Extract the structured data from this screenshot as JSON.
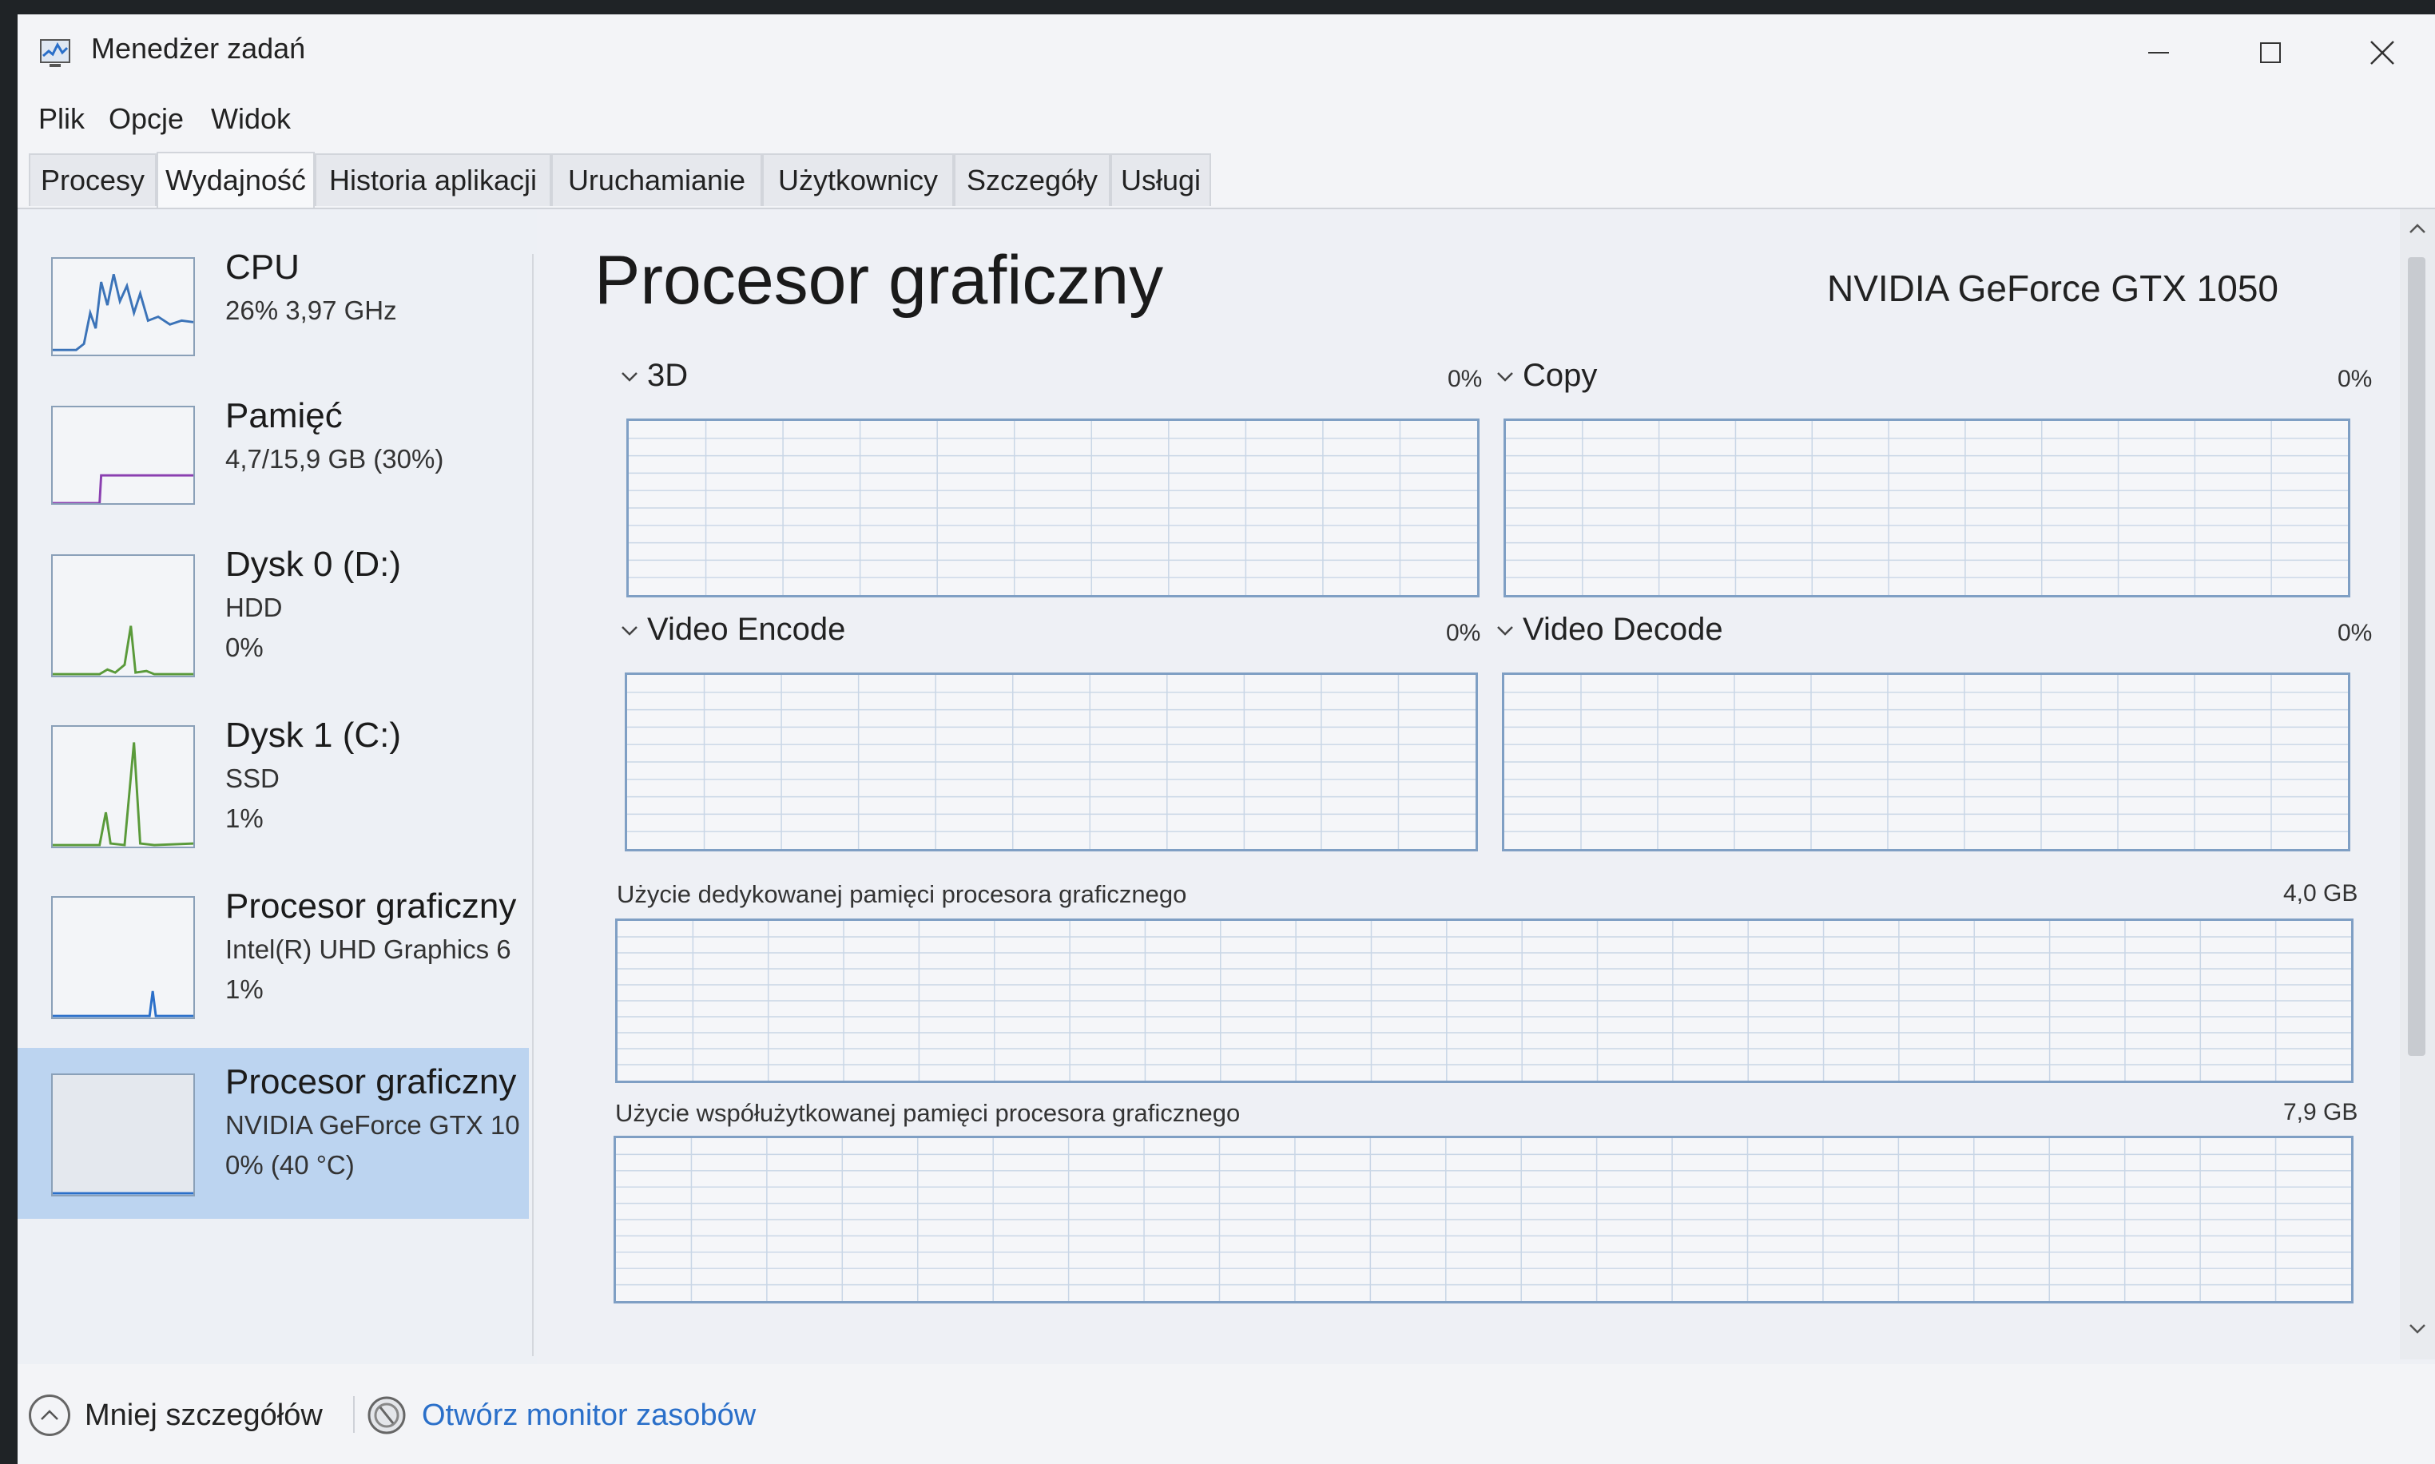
{
  "window": {
    "title": "Menedżer zadań"
  },
  "menu": [
    "Plik",
    "Opcje",
    "Widok"
  ],
  "tabs": [
    "Procesy",
    "Wydajność",
    "Historia aplikacji",
    "Uruchamianie",
    "Użytkownicy",
    "Szczegóły",
    "Usługi"
  ],
  "active_tab": "Wydajność",
  "sidebar": {
    "items": [
      {
        "name": "CPU",
        "line2": "26% 3,97 GHz",
        "line3": ""
      },
      {
        "name": "Pamięć",
        "line2": "4,7/15,9 GB (30%)",
        "line3": ""
      },
      {
        "name": "Dysk 0 (D:)",
        "line2": "HDD",
        "line3": "0%"
      },
      {
        "name": "Dysk 1 (C:)",
        "line2": "SSD",
        "line3": "1%"
      },
      {
        "name": "Procesor graficzny",
        "line2": "Intel(R) UHD Graphics 6",
        "line3": "1%"
      },
      {
        "name": "Procesor graficzny",
        "line2": "NVIDIA GeForce GTX 10",
        "line3": "0% (40 °C)"
      }
    ],
    "selected_index": 5
  },
  "main": {
    "title": "Procesor graficzny",
    "device": "NVIDIA GeForce GTX 1050",
    "engines": [
      {
        "label": "3D",
        "pct": "0%"
      },
      {
        "label": "Copy",
        "pct": "0%"
      },
      {
        "label": "Video Encode",
        "pct": "0%"
      },
      {
        "label": "Video Decode",
        "pct": "0%"
      }
    ],
    "dedicated": {
      "label": "Użycie dedykowanej pamięci procesora graficznego",
      "max": "4,0 GB"
    },
    "shared": {
      "label": "Użycie współużytkowanej pamięci procesora graficznego",
      "max": "7,9 GB"
    }
  },
  "footer": {
    "less_details": "Mniej szczegółów",
    "open_monitor": "Otwórz monitor zasobów"
  },
  "colors": {
    "accent": "#2a6fc9",
    "graph_border": "#7f9fc4",
    "grid": "#c9d6e6",
    "selected_bg": "#bcd4f0",
    "cpu_line": "#3b73b8",
    "memory_line": "#8a3fb0",
    "disk_line": "#5a9a3a",
    "gpu_line": "#2a6fc9"
  }
}
